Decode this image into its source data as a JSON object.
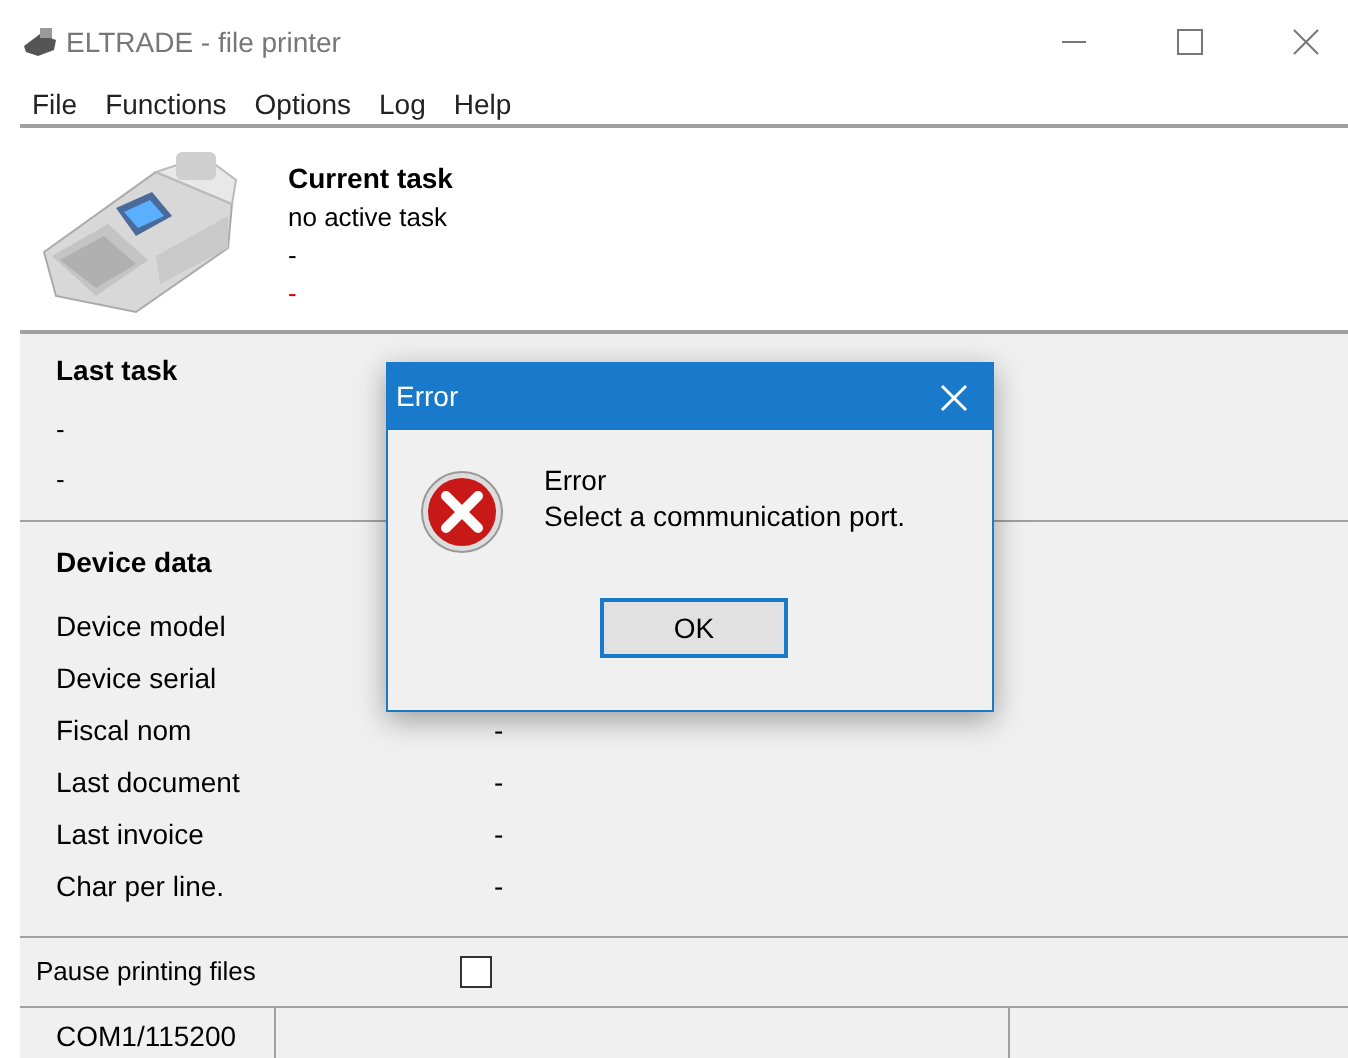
{
  "window": {
    "title": "ELTRADE - file printer"
  },
  "menu": [
    "File",
    "Functions",
    "Options",
    "Log",
    "Help"
  ],
  "current_task": {
    "heading": "Current task",
    "lines": [
      {
        "text": "no active task",
        "kind": "normal"
      },
      {
        "text": "-",
        "kind": "normal"
      },
      {
        "text": "-",
        "kind": "alert"
      }
    ]
  },
  "last_task": {
    "heading": "Last task",
    "lines": [
      "-",
      "-"
    ]
  },
  "device_data": {
    "heading": "Device data",
    "rows": [
      {
        "label": "Device model"
      },
      {
        "label": "Device serial"
      },
      {
        "label": "Fiscal nom",
        "value": "-"
      },
      {
        "label": "Last document",
        "value": "-"
      },
      {
        "label": "Last invoice",
        "value": "-"
      },
      {
        "label": "Char per line.",
        "value": "-"
      }
    ]
  },
  "pause": {
    "label": "Pause printing files",
    "checked": false
  },
  "status_bar": [
    "COM1/115200"
  ],
  "dialog": {
    "title": "Error",
    "heading": "Error",
    "message": "Select a communication port.",
    "button": "OK"
  }
}
